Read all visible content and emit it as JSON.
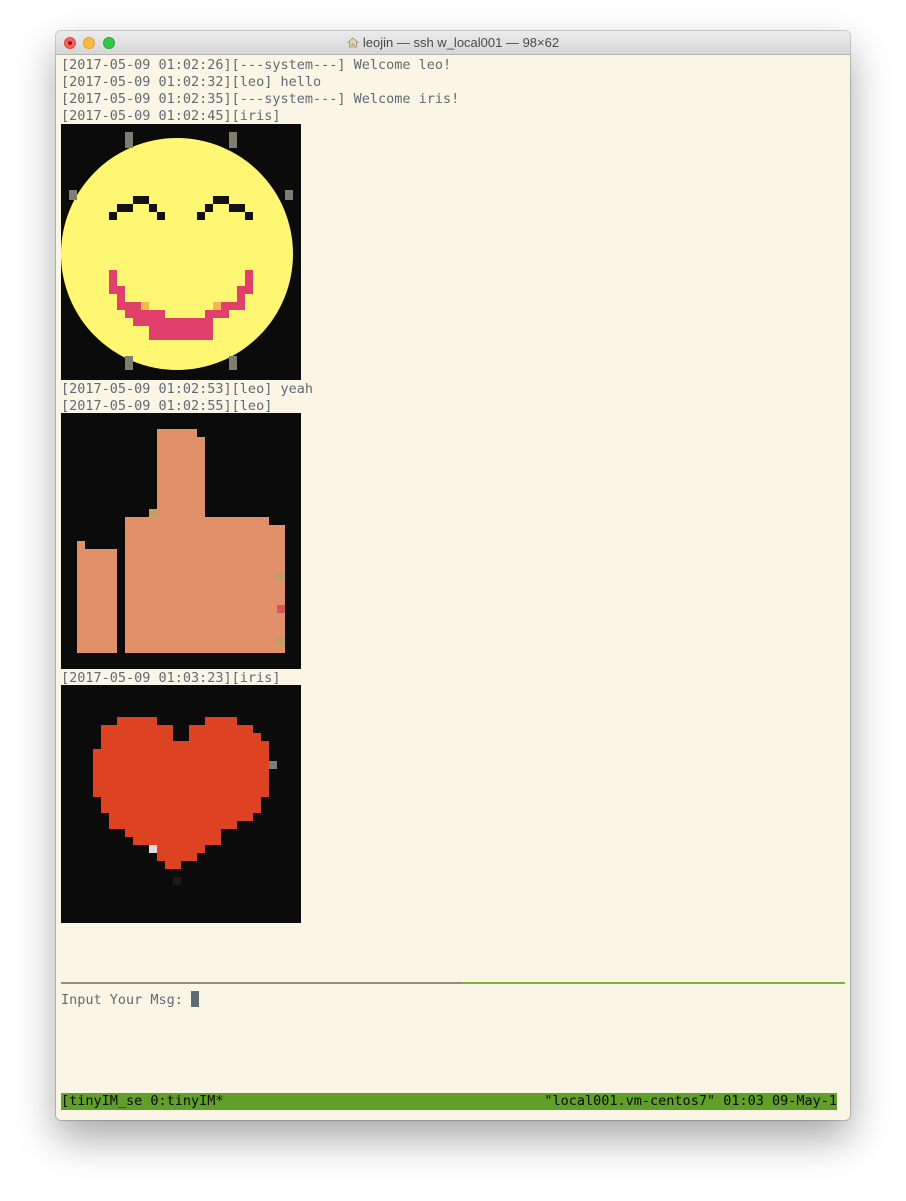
{
  "window": {
    "title": "leojin — ssh w_local001 — 98×62"
  },
  "messages": [
    {
      "text": "[2017-05-09 01:02:26][---system---] Welcome leo!"
    },
    {
      "text": "[2017-05-09 01:02:32][leo] hello"
    },
    {
      "text": "[2017-05-09 01:02:35][---system---] Welcome iris!"
    },
    {
      "text": "[2017-05-09 01:02:45][iris]",
      "image": "laughing-smiley-emoji"
    },
    {
      "text": "[2017-05-09 01:02:53][leo] yeah"
    },
    {
      "text": "[2017-05-09 01:02:55][leo]",
      "image": "thumbs-up-emoji"
    },
    {
      "text": "[2017-05-09 01:03:23][iris]",
      "image": "red-heart-emoji"
    }
  ],
  "input": {
    "prompt": "Input Your Msg: "
  },
  "status_bar": {
    "left": "[tinyIM_se 0:tinyIM*",
    "right": "\"local001.vm-centos7\" 01:03 09-May-1"
  },
  "colors": {
    "terminal_bg": "#fbf5e5",
    "terminal_text": "#5f6b73",
    "status_bar_bg": "#5f9f2a",
    "divider_accent": "#7bb241"
  }
}
